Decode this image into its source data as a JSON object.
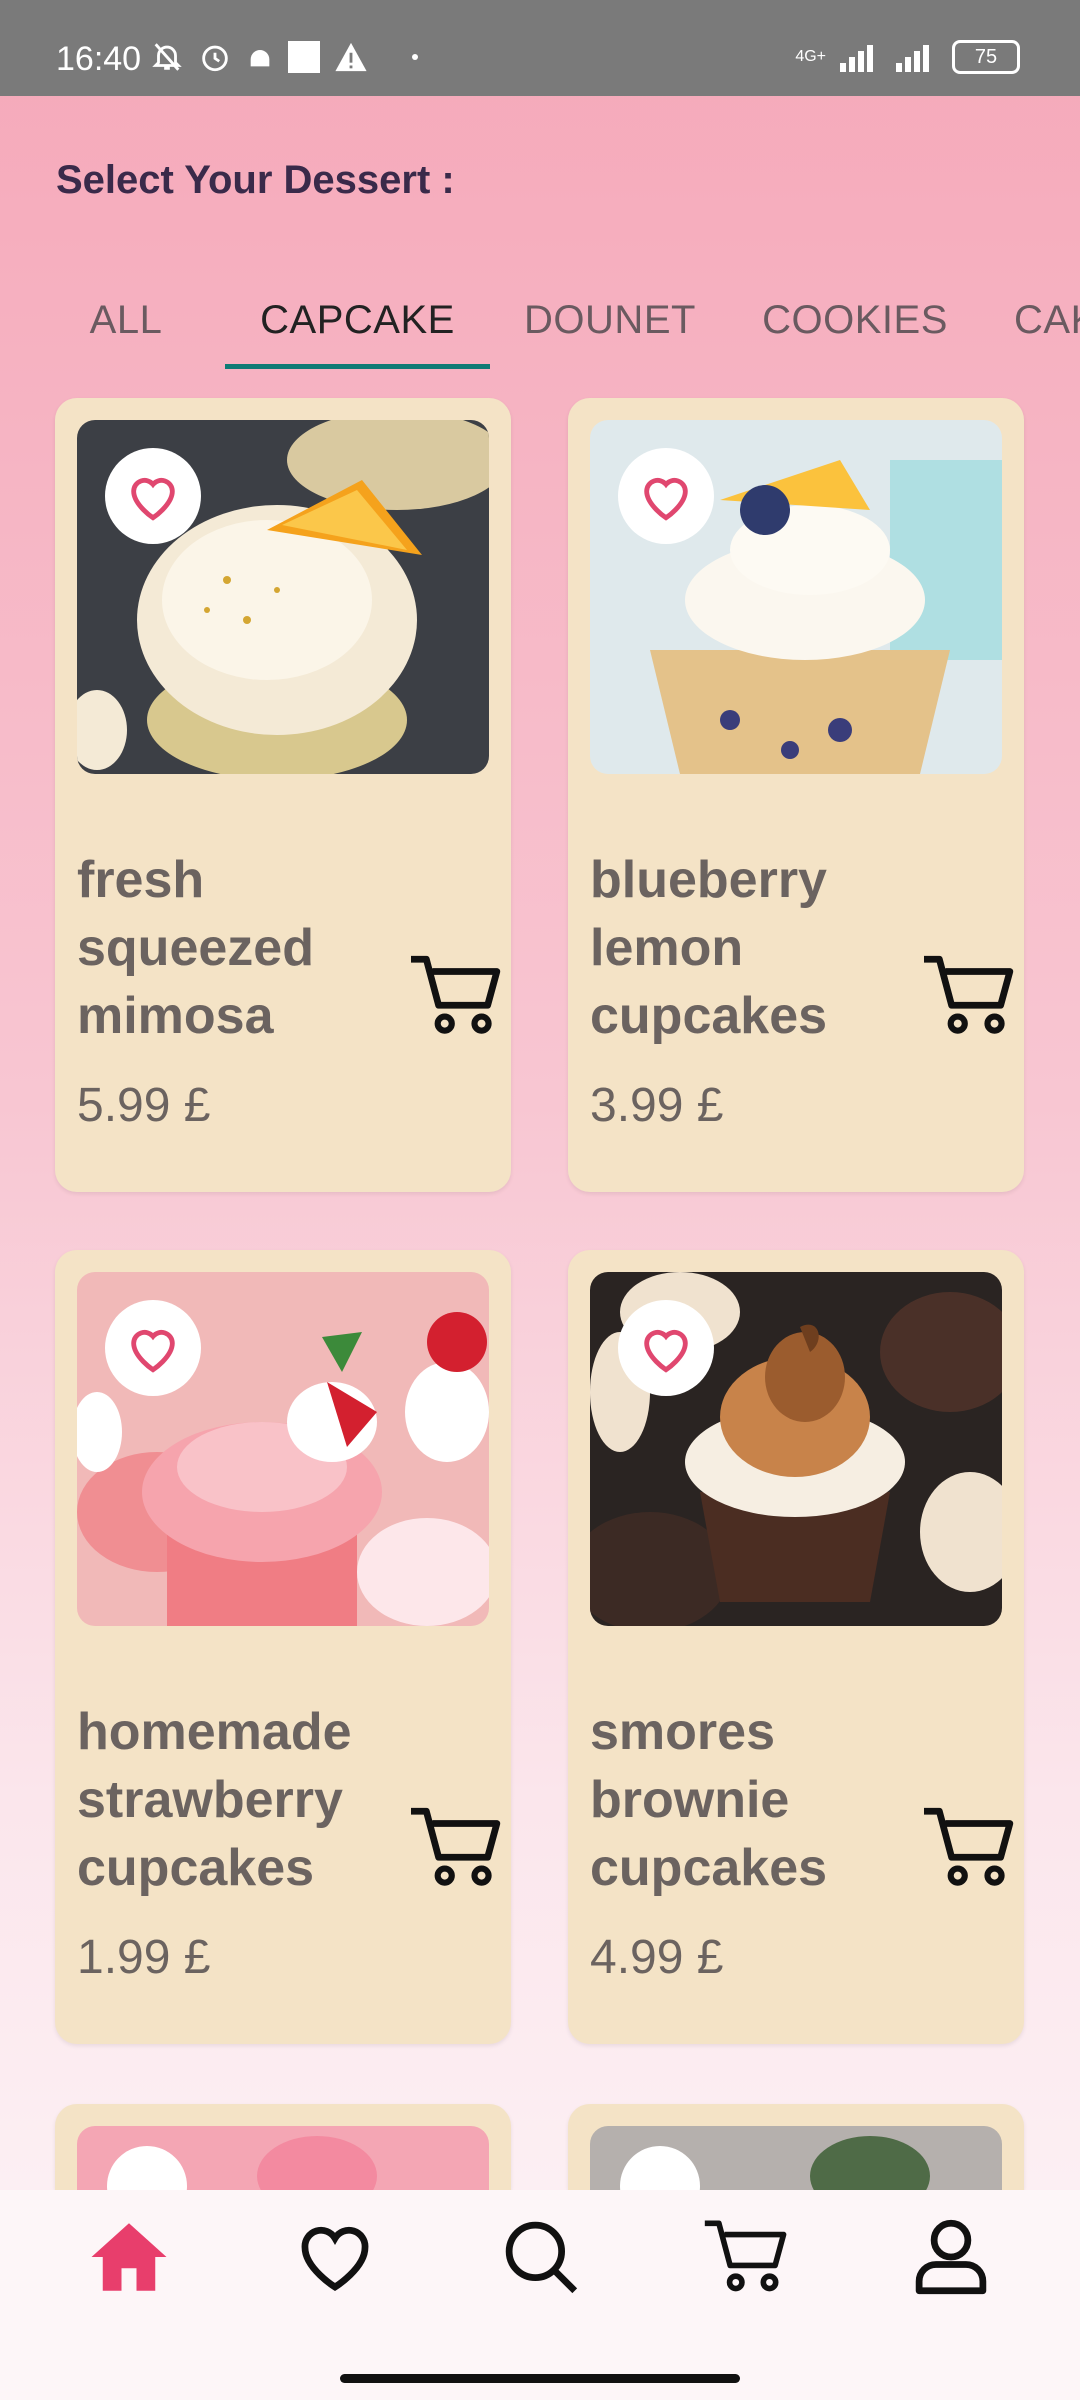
{
  "status_bar": {
    "time": "16:40",
    "network": "4G+",
    "battery": "75"
  },
  "header": {
    "title": "Select Your Dessert :"
  },
  "tabs": [
    {
      "label": "ALL",
      "active": false
    },
    {
      "label": "CAPCAKE",
      "active": true
    },
    {
      "label": "DOUNET",
      "active": false
    },
    {
      "label": "COOKIES",
      "active": false
    },
    {
      "label": "CAKE",
      "active": false
    }
  ],
  "colors": {
    "accent": "#e83e6c",
    "tab_indicator": "#0f7b75",
    "card_bg": "#f4e3c6"
  },
  "products": [
    {
      "name": "fresh squeezed mimosa",
      "price": "5.99 £",
      "image": "orange-topped-cupcake"
    },
    {
      "name": "blueberry lemon cupcakes",
      "price": "3.99 £",
      "image": "blueberry-cupcake"
    },
    {
      "name": "homemade strawberry cupcakes",
      "price": "1.99 £",
      "image": "strawberry-cupcake"
    },
    {
      "name": "smores brownie cupcakes",
      "price": "4.99 £",
      "image": "smores-cupcake"
    }
  ],
  "bottom_nav": [
    {
      "icon": "home-icon",
      "active": true
    },
    {
      "icon": "heart-icon",
      "active": false
    },
    {
      "icon": "search-icon",
      "active": false
    },
    {
      "icon": "cart-icon",
      "active": false
    },
    {
      "icon": "profile-icon",
      "active": false
    }
  ]
}
